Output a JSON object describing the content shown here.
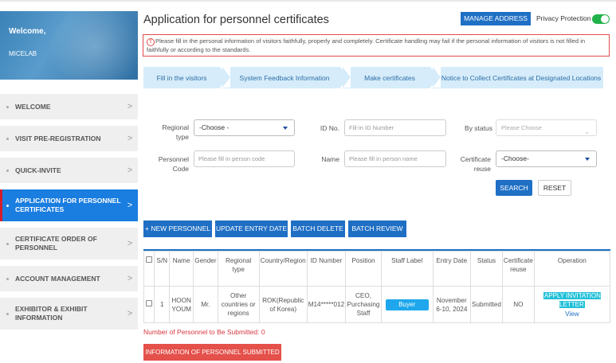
{
  "sidebar": {
    "welcome_title": "Welcome,",
    "user_name": "MICELAB",
    "items": [
      {
        "label": "WELCOME"
      },
      {
        "label": "VISIT PRE-REGISTRATION"
      },
      {
        "label": "QUICK-INVITE"
      },
      {
        "label": "APPLICATION FOR PERSONNEL CERTIFICATES"
      },
      {
        "label": "CERTIFICATE ORDER OF PERSONNEL"
      },
      {
        "label": "ACCOUNT MANAGEMENT"
      },
      {
        "label": "EXHIBITOR & EXHIBIT INFORMATION"
      }
    ],
    "active_index": 3,
    "chevron": ">"
  },
  "header": {
    "title": "Application for personnel certificates",
    "manage_address": "MANAGE ADDRESS",
    "privacy_label": "Privacy Protection",
    "privacy_on": true
  },
  "notice": {
    "icon": "!",
    "text": "Please fill in the personal information of visitors faithfully, properly and completely. Certificate handling may fail if the personal information of visitors is not filled in faithfully or according to the standards."
  },
  "steps": [
    {
      "label": "Fill in the visitors"
    },
    {
      "label": "System Feedback Information"
    },
    {
      "label": "Make certificates"
    },
    {
      "label": "Notice to Collect Certificates at Designated Locations"
    }
  ],
  "filters": {
    "regional_type_label": "Regional type",
    "regional_type_value": "-Choose -",
    "id_no_label": "ID No.",
    "id_no_placeholder": "Fill-in ID Number",
    "by_status_label": "By status",
    "by_status_placeholder": "Please Choose",
    "personnel_code_label": "Personnel Code",
    "personnel_code_placeholder": "Please fill in person code",
    "name_label": "Name",
    "name_placeholder": "Please fill in person name",
    "cert_reuse_label": "Certificate reuse",
    "cert_reuse_value": "-Choose-",
    "search": "SEARCH",
    "reset": "RESET"
  },
  "actions": {
    "new_personnel": "+ NEW PERSONNEL",
    "update_entry_date": "UPDATE ENTRY DATE",
    "batch_delete": "BATCH DELETE",
    "batch_review": "BATCH REVIEW"
  },
  "table": {
    "headers": [
      "S/N",
      "Name",
      "Gender",
      "Regional type",
      "Country/Region",
      "ID Number",
      "Position",
      "Staff Label",
      "Entry Date",
      "Status",
      "Certificate reuse",
      "Operation"
    ],
    "rows": [
      {
        "sn": "1",
        "name": "HOON YOUM",
        "gender": "Mr.",
        "regional_type": "Other countries or regions",
        "country": "ROK(Republic of Korea)",
        "id_number": "M14*****012",
        "position": "CEO, Purchasing Staff",
        "staff_label": "Buyer",
        "entry_date": "November 6-10, 2024",
        "status": "Submitted",
        "cert_reuse": "NO",
        "op_apply": "APPLY INVITATION LETTER",
        "op_view": "View"
      }
    ]
  },
  "footer": {
    "submitted_count": "Number of Personnel to Be Submitted: 0",
    "submit_button": "INFORMATION OF PERSONNEL SUBMITTED"
  },
  "colors": {
    "primary": "#1f6fc5",
    "active_menu": "#1a7de0",
    "danger": "#e4504a",
    "step_bg": "#d6ecfa",
    "toggle_on": "#22b24c",
    "staff_badge": "#1ea7ec"
  }
}
